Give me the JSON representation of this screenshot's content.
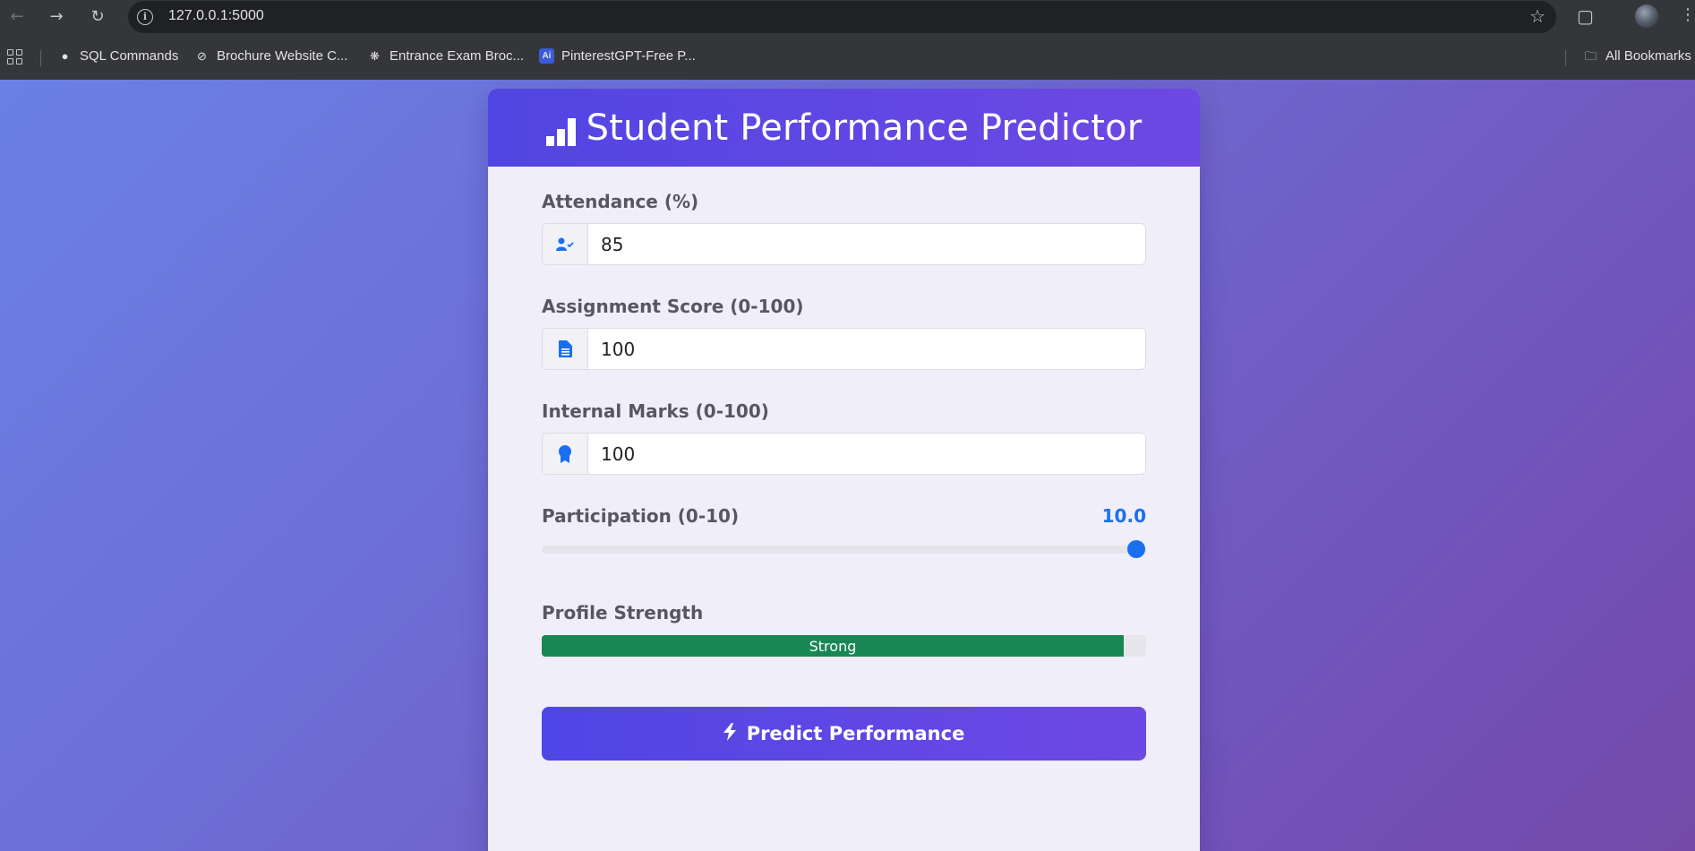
{
  "browser": {
    "url": "127.0.0.1:5000",
    "bookmarks": [
      {
        "label": "SQL Commands",
        "icon": "globe-icon"
      },
      {
        "label": "Brochure Website C...",
        "icon": "link-off-icon"
      },
      {
        "label": "Entrance Exam Broc...",
        "icon": "openai-icon"
      },
      {
        "label": "PinterestGPT-Free P...",
        "icon": "ai-icon"
      }
    ],
    "all_bookmarks_label": "All Bookmarks"
  },
  "app": {
    "title": "Student Performance Predictor",
    "fields": {
      "attendance": {
        "label": "Attendance (%)",
        "value": "85",
        "icon": "user-check-icon"
      },
      "assignment": {
        "label": "Assignment Score (0-100)",
        "value": "100",
        "icon": "file-icon"
      },
      "internal": {
        "label": "Internal Marks (0-100)",
        "value": "100",
        "icon": "award-icon"
      }
    },
    "participation": {
      "label": "Participation (0-10)",
      "value_text": "10.0",
      "value": 10,
      "max": 10
    },
    "profile_strength": {
      "label": "Profile Strength",
      "status": "Strong",
      "fraction": 0.963
    },
    "predict_button": "Predict Performance"
  },
  "colors": {
    "accent": "#1a6ff0",
    "header_start": "#5146e3",
    "header_end": "#6e48e3",
    "strength": "#198754"
  }
}
